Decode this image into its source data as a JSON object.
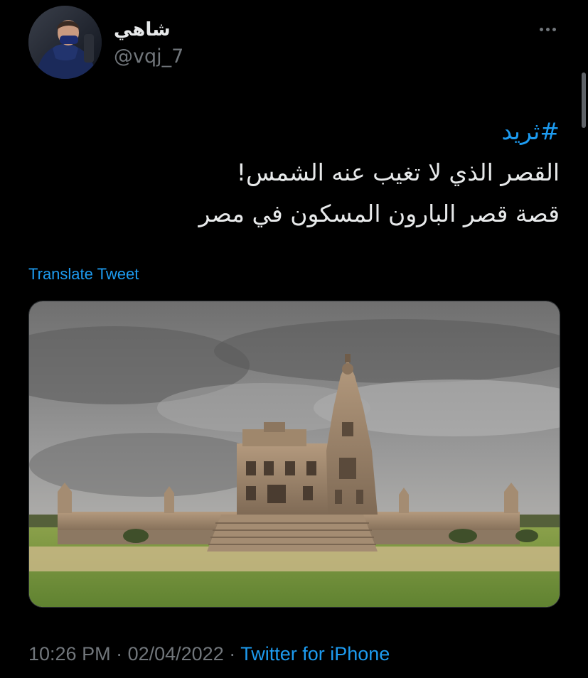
{
  "author": {
    "display_name": "شاهي",
    "handle": "@vqj_7"
  },
  "tweet": {
    "hashtag": "#ثريد",
    "line1": "القصر الذي لا تغيب عنه الشمس!",
    "line2": "قصة قصر البارون المسكون في مصر"
  },
  "translate_label": "Translate Tweet",
  "meta": {
    "time": "10:26 PM",
    "separator": " · ",
    "date": "02/04/2022",
    "source": "Twitter for iPhone"
  },
  "icons": {
    "more": "more-horizontal-icon"
  },
  "colors": {
    "background": "#000000",
    "text_primary": "#e7e9ea",
    "text_secondary": "#71767b",
    "accent": "#1d9bf0"
  }
}
